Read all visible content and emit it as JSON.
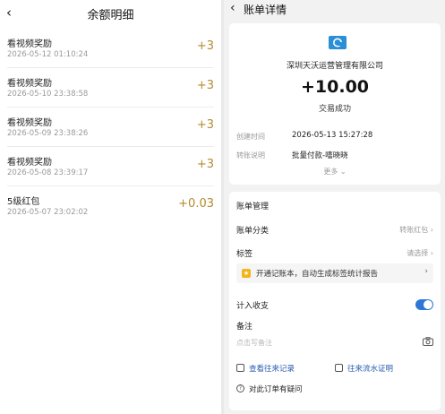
{
  "left": {
    "back_icon": "chevron-left-icon",
    "title": "余额明细",
    "rows": [
      {
        "name": "看视频奖励",
        "time": "2026-05-12 01:10:24",
        "amount": "+3"
      },
      {
        "name": "看视频奖励",
        "time": "2026-05-10 23:38:58",
        "amount": "+3"
      },
      {
        "name": "看视频奖励",
        "time": "2026-05-09 23:38:26",
        "amount": "+3"
      },
      {
        "name": "看视频奖励",
        "time": "2026-05-08 23:39:17",
        "amount": "+3"
      },
      {
        "name": "5级红包",
        "time": "2026-05-07 23:02:02",
        "amount": "+0.03"
      }
    ],
    "amount_color": "#b48a2e"
  },
  "right": {
    "back_icon": "chevron-left-icon",
    "title": "账单详情",
    "company": "深圳天沃运营管理有限公司",
    "amount": "+10.00",
    "status": "交易成功",
    "create_time_label": "创建时间",
    "create_time_value": "2026-05-13 15:27:28",
    "transfer_note_label": "转账说明",
    "transfer_note_value": "批量付款-嘻晓晓",
    "more": "更多",
    "manage": {
      "title": "账单管理",
      "category_label": "账单分类",
      "category_value": "转账红包",
      "tag_label": "标签",
      "tag_value": "请选择",
      "promo_text": "开通记账本，自动生成标签统计报告",
      "income_label": "计入收支",
      "income_enabled": true,
      "note_label": "备注",
      "note_placeholder": "点击写备注",
      "link_records": "查看往来记录",
      "link_proof": "往来流水证明",
      "ask": "对此订单有疑问"
    },
    "accent_color": "#2d77d7"
  }
}
